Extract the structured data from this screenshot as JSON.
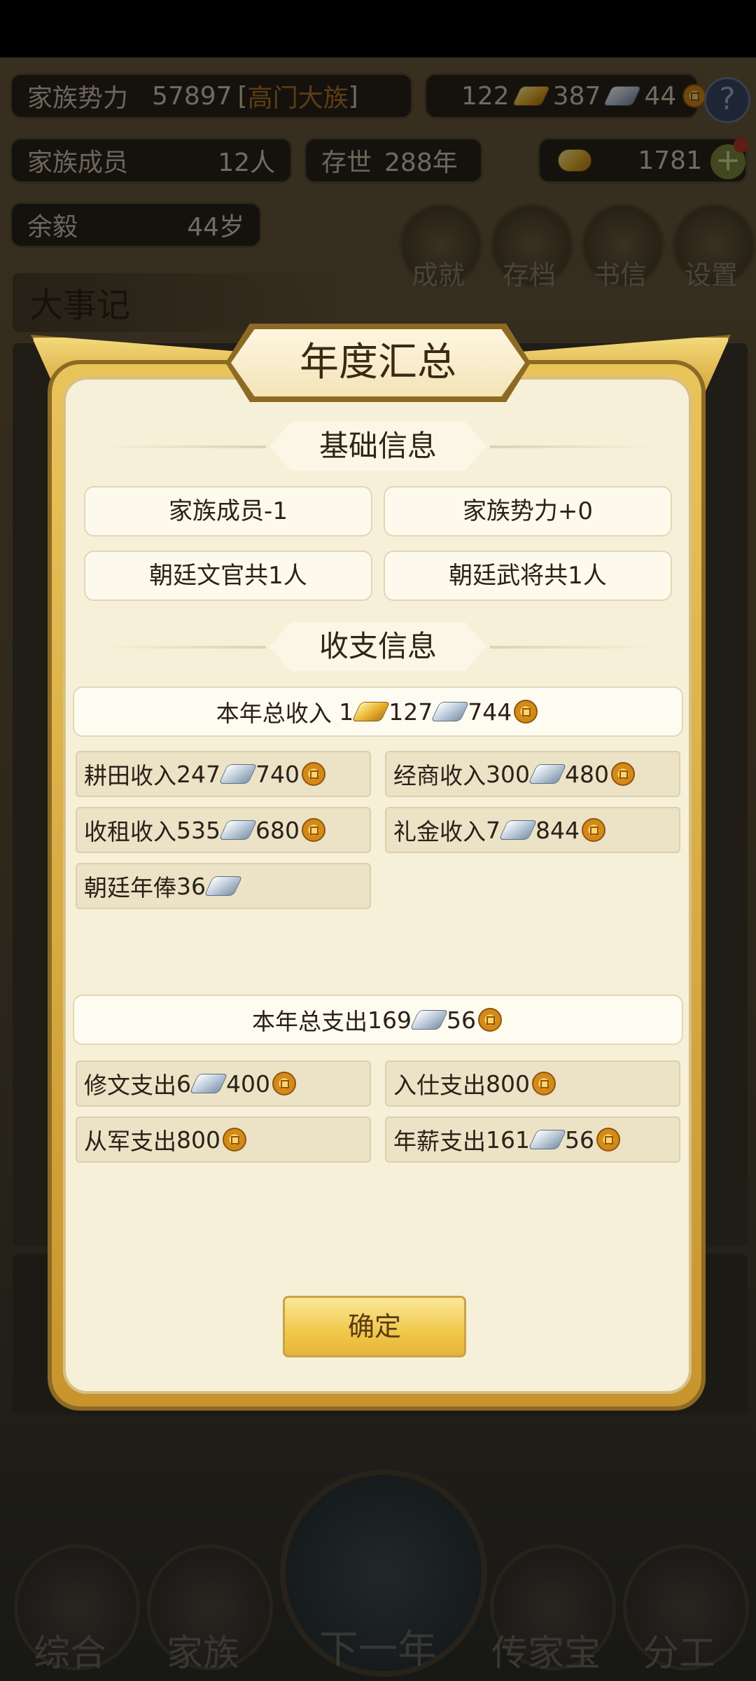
{
  "hud": {
    "clan_power_label": "家族势力",
    "clan_power_value": "57897",
    "clan_rank_open": "[",
    "clan_rank": "高门大族",
    "clan_rank_close": "]",
    "gold_count": "122",
    "silver_count": "387",
    "coin_count": "44",
    "help_glyph": "?",
    "members_label": "家族成员",
    "members_value": "12人",
    "existence_label": "存世",
    "existence_value": "288年",
    "yuanbao_value": "1781",
    "plus_glyph": "+",
    "person_name": "余毅",
    "person_age": "44岁",
    "menu": [
      {
        "label": "成就"
      },
      {
        "label": "存档"
      },
      {
        "label": "书信"
      },
      {
        "label": "设置"
      }
    ],
    "events_title": "大事记"
  },
  "modal": {
    "title": "年度汇总",
    "basic_section": "基础信息",
    "basic_items": [
      "家族成员-1",
      "家族势力+0",
      "朝廷文官共1人",
      "朝廷武将共1人"
    ],
    "finance_section": "收支信息",
    "income_total": {
      "prefix": "本年总收入 ",
      "gold": "1",
      "silver": "127",
      "coin": "744"
    },
    "income_items": [
      {
        "label": "耕田收入",
        "silver": "247",
        "coin": "740"
      },
      {
        "label": "经商收入",
        "silver": "300",
        "coin": "480"
      },
      {
        "label": "收租收入",
        "silver": "535",
        "coin": "680"
      },
      {
        "label": "礼金收入",
        "silver": "7",
        "coin": "844"
      },
      {
        "label": "朝廷年俸",
        "silver": "36"
      }
    ],
    "expense_total": {
      "prefix": "本年总支出",
      "silver": "169",
      "coin": "56"
    },
    "expense_items": [
      {
        "label": "修文支出",
        "silver": "6",
        "coin": "400"
      },
      {
        "label": "入仕支出",
        "coin": "800"
      },
      {
        "label": "从军支出",
        "coin": "800"
      },
      {
        "label": "年薪支出",
        "silver": "161",
        "coin": "56"
      }
    ],
    "confirm_label": "确定"
  },
  "bottom_nav": [
    {
      "label": "综合"
    },
    {
      "label": "家族"
    },
    {
      "label": "下一年"
    },
    {
      "label": "传家宝"
    },
    {
      "label": "分工"
    }
  ],
  "colors": {
    "accent_gold": "#e9c45a",
    "panel_bg": "#f7f0d8",
    "rank_text": "#b3752b"
  }
}
